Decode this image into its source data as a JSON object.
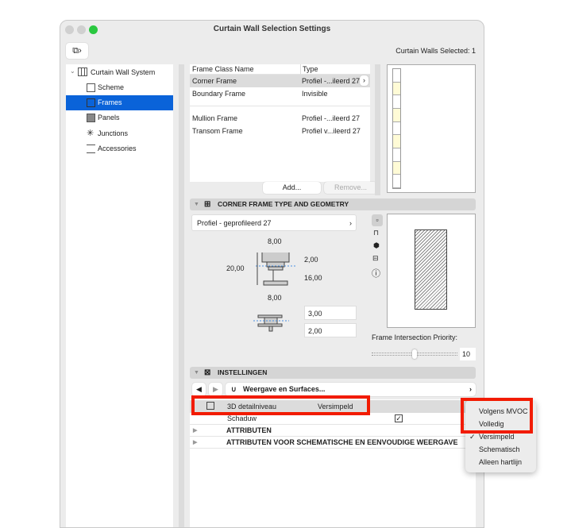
{
  "window": {
    "title": "Curtain Wall Selection Settings",
    "selected_count": "Curtain Walls Selected: 1"
  },
  "sidebar": {
    "root": "Curtain Wall System",
    "items": [
      {
        "label": "Scheme"
      },
      {
        "label": "Frames"
      },
      {
        "label": "Panels"
      },
      {
        "label": "Junctions"
      },
      {
        "label": "Accessories"
      }
    ]
  },
  "frame_list": {
    "headers": [
      "Frame Class Name",
      "Type"
    ],
    "rows": [
      {
        "name": "Corner Frame",
        "type": "Profiel -...ileerd 27"
      },
      {
        "name": "Boundary Frame",
        "type": "Invisible"
      },
      {
        "name": "Mullion Frame",
        "type": "Profiel -...ileerd 27"
      },
      {
        "name": "Transom Frame",
        "type": "Profiel v...ileerd 27"
      }
    ],
    "add": "Add...",
    "remove": "Remove..."
  },
  "geometry": {
    "title": "CORNER FRAME TYPE AND GEOMETRY",
    "profile": "Profiel - geprofileerd 27",
    "dim_top": "8,00",
    "dim_height": "20,00",
    "dim_flange": "2,00",
    "dim_web": "16,00",
    "dim_bottom": "8,00",
    "offset1": "3,00",
    "offset2": "2,00",
    "priority_label": "Frame Intersection Priority:",
    "priority_value": "10",
    "priority_fraction": 0.5
  },
  "settings": {
    "title": "INSTELLINGEN",
    "nav_label": "Weergave en Surfaces...",
    "rows": [
      {
        "label": "3D detailniveau",
        "value": "Versimpeld"
      },
      {
        "label": "Schaduw",
        "checked": true
      }
    ],
    "groups": [
      "ATTRIBUTEN",
      "ATTRIBUTEN VOOR SCHEMATISCHE EN EENVOUDIGE WEERGAVE"
    ]
  },
  "dropdown": {
    "options": [
      "Volgens MVOC",
      "Volledig",
      "Versimpeld",
      "Schematisch",
      "Alleen hartlijn"
    ],
    "selected": "Versimpeld",
    "check": "✓"
  },
  "colors": {
    "accent": "#0a63d9",
    "highlight": "#f21b00",
    "panel_fill": "#fffbd6"
  }
}
